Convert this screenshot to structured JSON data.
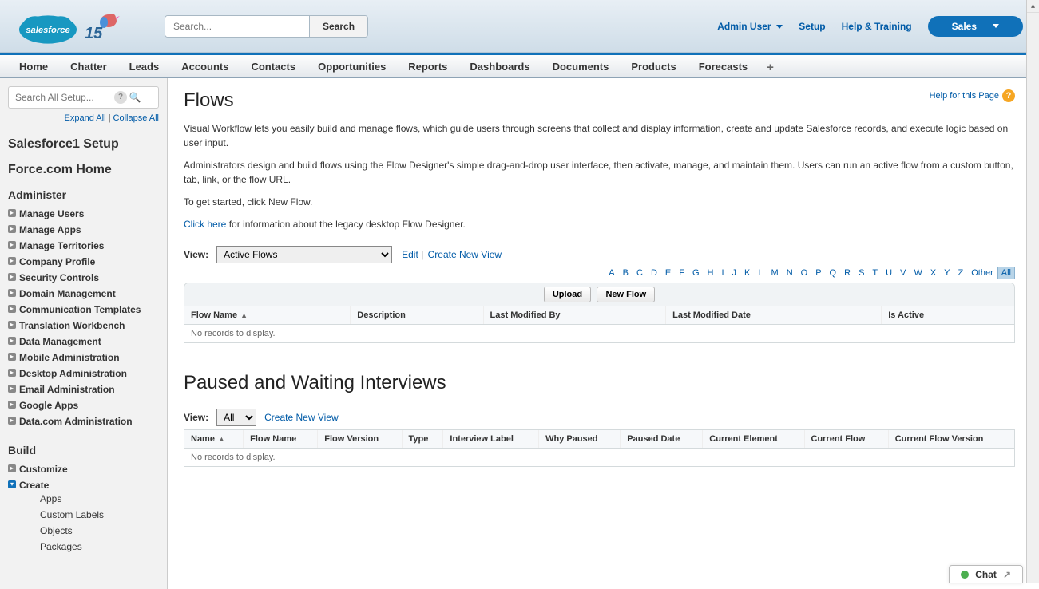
{
  "header": {
    "search_placeholder": "Search...",
    "search_button": "Search",
    "user_name": "Admin User",
    "links": {
      "setup": "Setup",
      "help": "Help & Training"
    },
    "app_menu": "Sales"
  },
  "tabs": [
    "Home",
    "Chatter",
    "Leads",
    "Accounts",
    "Contacts",
    "Opportunities",
    "Reports",
    "Dashboards",
    "Documents",
    "Products",
    "Forecasts"
  ],
  "sidebar": {
    "search_placeholder": "Search All Setup...",
    "expand": "Expand All",
    "collapse": "Collapse All",
    "sf1_setup": "Salesforce1 Setup",
    "force_home": "Force.com Home",
    "administer_title": "Administer",
    "admin_items": [
      "Manage Users",
      "Manage Apps",
      "Manage Territories",
      "Company Profile",
      "Security Controls",
      "Domain Management",
      "Communication Templates",
      "Translation Workbench",
      "Data Management",
      "Mobile Administration",
      "Desktop Administration",
      "Email Administration",
      "Google Apps",
      "Data.com Administration"
    ],
    "build_title": "Build",
    "build_items": {
      "customize": "Customize",
      "create": "Create",
      "create_children": [
        "Apps",
        "Custom Labels",
        "Objects",
        "Packages"
      ]
    }
  },
  "main": {
    "title": "Flows",
    "help_label": "Help for this Page",
    "desc1": "Visual Workflow lets you easily build and manage flows, which guide users through screens that collect and display information, create and update Salesforce records, and execute logic based on user input.",
    "desc2": "Administrators design and build flows using the Flow Designer's simple drag-and-drop user interface, then activate, manage, and maintain them. Users can run an active flow from a custom button, tab, link, or the flow URL.",
    "desc3": "To get started, click New Flow.",
    "click_here": "Click here",
    "desc4_rest": " for information about the legacy desktop Flow Designer.",
    "view_label": "View:",
    "view_select": "Active Flows",
    "edit": "Edit",
    "create_view": "Create New View",
    "alpha": [
      "A",
      "B",
      "C",
      "D",
      "E",
      "F",
      "G",
      "H",
      "I",
      "J",
      "K",
      "L",
      "M",
      "N",
      "O",
      "P",
      "Q",
      "R",
      "S",
      "T",
      "U",
      "V",
      "W",
      "X",
      "Y",
      "Z",
      "Other",
      "All"
    ],
    "upload_btn": "Upload",
    "new_flow_btn": "New Flow",
    "flow_cols": [
      "Flow Name",
      "Description",
      "Last Modified By",
      "Last Modified Date",
      "Is Active"
    ],
    "no_records": "No records to display.",
    "paused_title": "Paused and Waiting Interviews",
    "paused_view_label": "View:",
    "paused_view_select": "All",
    "paused_create_view": "Create New View",
    "paused_cols": [
      "Name",
      "Flow Name",
      "Flow Version",
      "Type",
      "Interview Label",
      "Why Paused",
      "Paused Date",
      "Current Element",
      "Current Flow",
      "Current Flow Version"
    ]
  },
  "chat": {
    "label": "Chat"
  }
}
